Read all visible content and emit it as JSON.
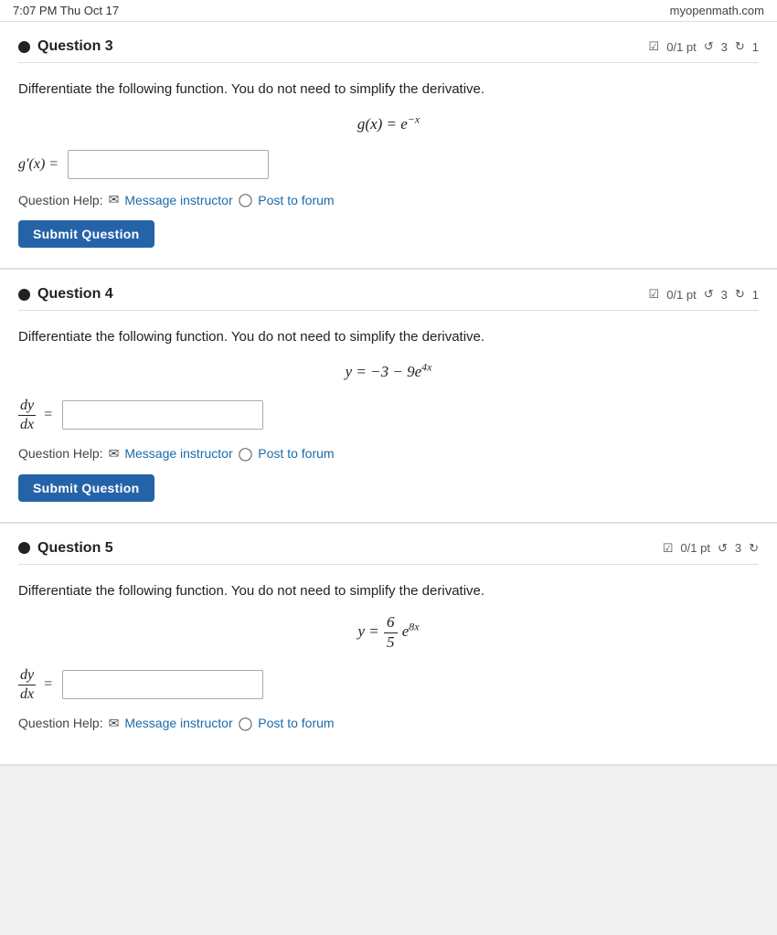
{
  "statusBar": {
    "time": "7:07 PM  Thu Oct 17",
    "site": "myopenmath.com"
  },
  "questions": [
    {
      "id": "q3",
      "label": "Question 3",
      "meta": "0/1 pt  ↺3  ↻1",
      "instruction": "Differentiate the following function. You do not need to simplify the derivative.",
      "functionDisplay": "g(x) = e⁻ˣ",
      "answerLabel": "g′(x) =",
      "answerType": "simple",
      "helpText": "Question Help:",
      "messageInstructor": "Message instructor",
      "postToForum": "Post to forum",
      "submitLabel": "Submit Question"
    },
    {
      "id": "q4",
      "label": "Question 4",
      "meta": "0/1 pt  ↺3  ↻1",
      "instruction": "Differentiate the following function. You do not need to simplify the derivative.",
      "functionDisplay": "y = −3 − 9e⁴ˣ",
      "answerLabel": "dy/dx =",
      "answerType": "dydx",
      "helpText": "Question Help:",
      "messageInstructor": "Message instructor",
      "postToForum": "Post to forum",
      "submitLabel": "Submit Question"
    },
    {
      "id": "q5",
      "label": "Question 5",
      "meta": "0/1 pt  ↺3  ↻",
      "instruction": "Differentiate the following function. You do not need to simplify the derivative.",
      "functionDisplay": "y = (6/5)e⁸ˣ",
      "answerLabel": "dy/dx =",
      "answerType": "dydx",
      "helpText": "Question Help:",
      "messageInstructor": "Message instructor",
      "postToForum": "Post to forum"
    }
  ]
}
